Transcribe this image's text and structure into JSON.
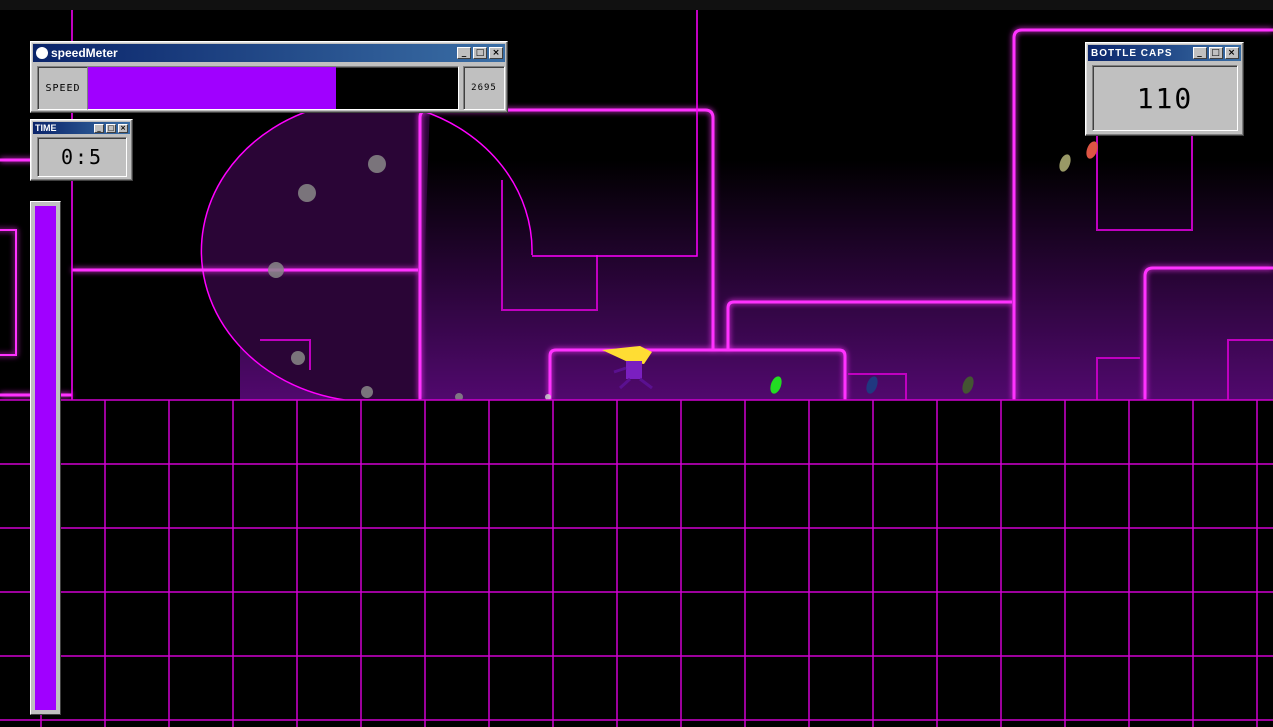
{
  "speedmeter": {
    "title": "speedMeter",
    "label": "SPEED",
    "value": "2695",
    "fill_fraction": 0.67
  },
  "time": {
    "title": "TIME",
    "value": "0:5"
  },
  "bottle_caps": {
    "title": "BOTTLE CAPS",
    "value": "110"
  },
  "side_meter": {
    "fill_fraction": 1.0
  },
  "window_controls": {
    "minimize": "_",
    "maximize": "□",
    "close": "×"
  },
  "colors": {
    "neon": "#ff33ff",
    "grid": "#d000d0",
    "meter": "#a000ff",
    "window_title": "#0a246a"
  },
  "collectibles": [
    "bottle-cap-green",
    "bottle-cap-blue",
    "bottle-cap-olive",
    "bottle-cap-red",
    "bottle-cap-khaki"
  ]
}
